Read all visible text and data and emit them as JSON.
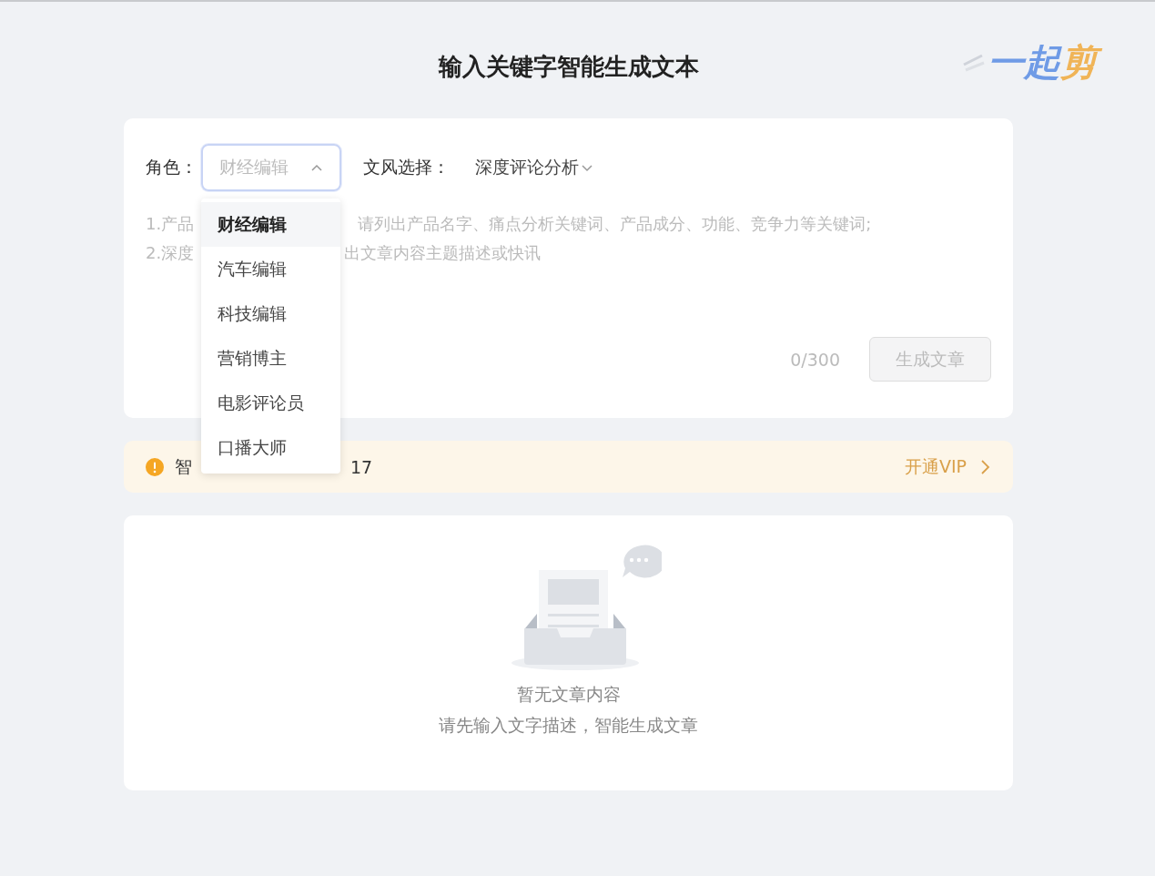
{
  "title": "输入关键字智能生成文本",
  "logo": {
    "parts": [
      {
        "text": "一",
        "color": "#6f9be6"
      },
      {
        "text": "起",
        "color": "#6f9be6"
      },
      {
        "text": "剪",
        "color": "#f0b457"
      }
    ]
  },
  "form": {
    "role": {
      "label": "角色：",
      "value": "财经编辑",
      "expanded": true,
      "options": [
        {
          "label": "财经编辑",
          "selected": true
        },
        {
          "label": "汽车编辑",
          "selected": false
        },
        {
          "label": "科技编辑",
          "selected": false
        },
        {
          "label": "营销博主",
          "selected": false
        },
        {
          "label": "电影评论员",
          "selected": false
        },
        {
          "label": "口播大师",
          "selected": false
        }
      ]
    },
    "style": {
      "label": "文风选择：",
      "value": "深度评论分析",
      "expanded": false
    },
    "prompt": {
      "placeholder_fragments": [
        [
          "1.产品",
          "请列出产品名字、痛点分析关键词、产品成分、功能、竞争力等关键词;"
        ],
        [
          "2.深度",
          "出文章内容主题描述或快讯"
        ]
      ]
    },
    "counter": "0/300",
    "generate_button": {
      "label": "生成文章",
      "disabled": true
    }
  },
  "notice": {
    "text_fragments": [
      "智",
      "17"
    ],
    "link": "开通VIP"
  },
  "empty": {
    "title": "暂无文章内容",
    "hint": "请先输入文字描述，智能生成文章"
  }
}
